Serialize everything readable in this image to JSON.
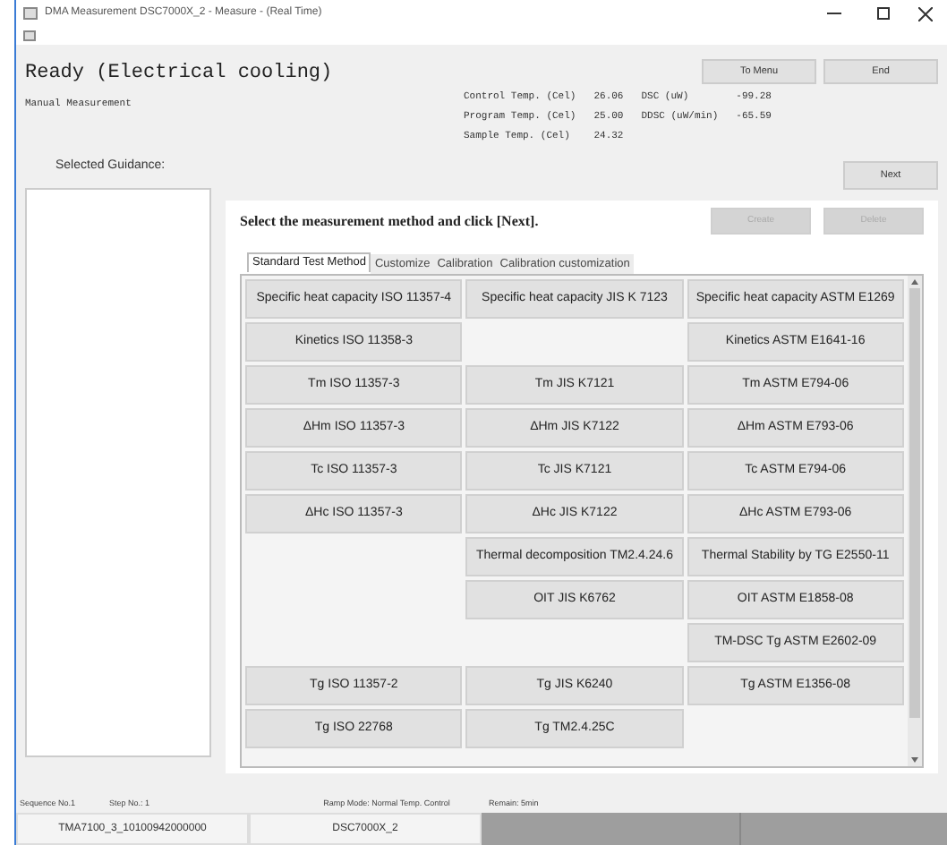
{
  "window": {
    "title": "DMA Measurement DSC7000X_2 - Measure - (Real Time)"
  },
  "status_title": "Ready (Electrical cooling)",
  "mode": "Manual Measurement",
  "readings": [
    {
      "label": "Control Temp. (Cel)",
      "value": "26.06"
    },
    {
      "label": "DSC (uW)",
      "value": "-99.28"
    },
    {
      "label": "Program Temp. (Cel)",
      "value": "25.00"
    },
    {
      "label": "DDSC (uW/min)",
      "value": "-65.59"
    },
    {
      "label": "Sample Temp. (Cel)",
      "value": "24.32"
    }
  ],
  "top_buttons": [
    "To Menu",
    "End"
  ],
  "next_button": "Next",
  "guidance_label": "Selected Guidance:",
  "instruction": "Select the measurement method and click [Next].",
  "action_buttons": [
    {
      "label": "Create",
      "disabled": true
    },
    {
      "label": "Delete",
      "disabled": true
    }
  ],
  "tabs": [
    {
      "label": "Standard Test Method",
      "selected": true
    },
    {
      "label": "Customize",
      "selected": false
    },
    {
      "label": "Calibration",
      "selected": false
    },
    {
      "label": "Calibration customization",
      "selected": false
    }
  ],
  "methods": [
    [
      {
        "kind": "method",
        "label": "Specific heat capacity ISO 11357-4"
      },
      {
        "kind": "method",
        "label": "Specific heat capacity JIS K 7123"
      },
      {
        "kind": "method",
        "label": "Specific heat capacity ASTM E1269"
      }
    ],
    [
      {
        "kind": "method",
        "label": "Kinetics ISO 11358-3"
      },
      {
        "kind": "empty"
      },
      {
        "kind": "method",
        "label": "Kinetics ASTM E1641-16"
      }
    ],
    [
      {
        "kind": "method",
        "label": "Tm ISO 11357-3"
      },
      {
        "kind": "method",
        "label": "Tm JIS K7121"
      },
      {
        "kind": "method",
        "label": "Tm ASTM E794-06"
      }
    ],
    [
      {
        "kind": "method",
        "label": "ΔHm ISO 11357-3"
      },
      {
        "kind": "method",
        "label": "ΔHm JIS K7122"
      },
      {
        "kind": "method",
        "label": "ΔHm ASTM E793-06"
      }
    ],
    [
      {
        "kind": "method",
        "label": "Tc ISO 11357-3"
      },
      {
        "kind": "method",
        "label": "Tc JIS K7121"
      },
      {
        "kind": "method",
        "label": "Tc ASTM E794-06"
      }
    ],
    [
      {
        "kind": "method",
        "label": "ΔHc ISO 11357-3"
      },
      {
        "kind": "method",
        "label": "ΔHc JIS K7122"
      },
      {
        "kind": "method",
        "label": "ΔHc ASTM E793-06"
      }
    ],
    [
      {
        "kind": "empty"
      },
      {
        "kind": "method",
        "label": "Thermal decomposition TM2.4.24.6"
      },
      {
        "kind": "method",
        "label": "Thermal Stability by TG E2550-11"
      }
    ],
    [
      {
        "kind": "empty"
      },
      {
        "kind": "method",
        "label": "OIT JIS K6762"
      },
      {
        "kind": "method",
        "label": "OIT ASTM E1858-08"
      }
    ],
    [
      {
        "kind": "empty"
      },
      {
        "kind": "empty"
      },
      {
        "kind": "method",
        "label": "TM-DSC Tg ASTM E2602-09"
      }
    ],
    [
      {
        "kind": "method",
        "label": "Tg ISO 11357-2"
      },
      {
        "kind": "method",
        "label": "Tg JIS K6240"
      },
      {
        "kind": "method",
        "label": "Tg ASTM E1356-08"
      }
    ],
    [
      {
        "kind": "method",
        "label": "Tg ISO 22768"
      },
      {
        "kind": "method",
        "label": "Tg TM2.4.25C"
      },
      {
        "kind": "empty"
      }
    ]
  ],
  "status_bar": {
    "labels": [
      "Sequence No.1",
      "Step No.: 1",
      "Ramp Mode: Normal Temp. Control",
      "Remain: 5min"
    ],
    "values": [
      "TMA7100_3_10100942000000",
      "DSC7000X_2"
    ]
  }
}
